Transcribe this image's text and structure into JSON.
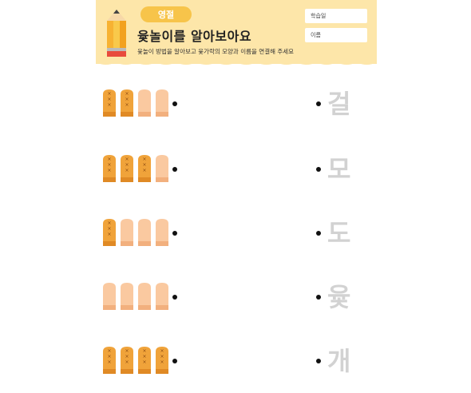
{
  "header": {
    "badge": "영절",
    "title": "윷놀이를 알아보아요",
    "instruction": "윷놀이 방법을 알아보고 윷가락의 모양과 이름을 연결해 주세요",
    "date_label": "학습일",
    "name_label": "이름"
  },
  "colors": {
    "header_bg": "#fde6a9",
    "badge": "#f7c44a",
    "stick_back": "#f0a33a",
    "stick_front": "#fac9a0",
    "label_gray": "#d2d2d2"
  },
  "rows": [
    {
      "stick_sides": [
        "back",
        "back",
        "front",
        "front"
      ],
      "label": "걸"
    },
    {
      "stick_sides": [
        "back",
        "back",
        "back",
        "front"
      ],
      "label": "모"
    },
    {
      "stick_sides": [
        "back",
        "front",
        "front",
        "front"
      ],
      "label": "도"
    },
    {
      "stick_sides": [
        "front",
        "front",
        "front",
        "front"
      ],
      "label": "윷"
    },
    {
      "stick_sides": [
        "back",
        "back",
        "back",
        "back"
      ],
      "label": "개"
    }
  ]
}
